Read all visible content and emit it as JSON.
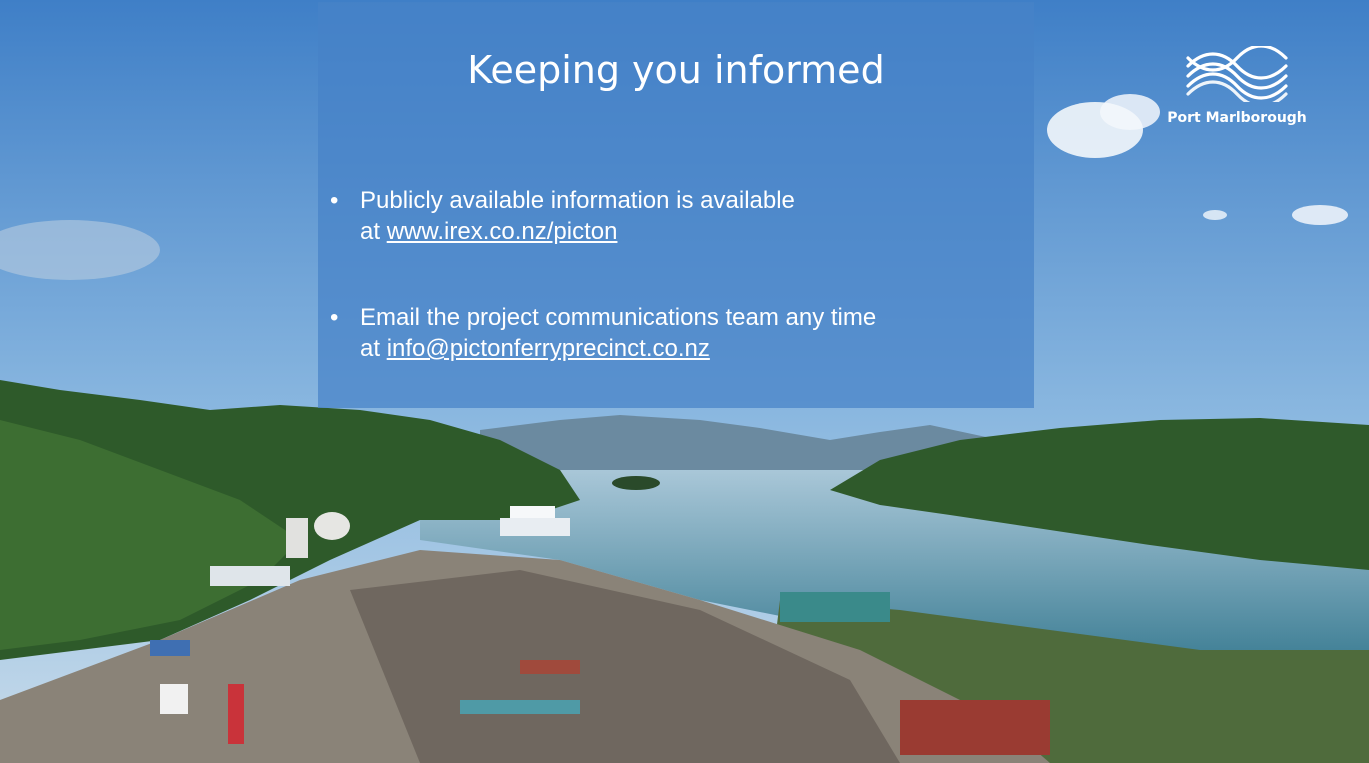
{
  "slide": {
    "title": "Keeping you informed",
    "bullets": [
      {
        "text": "Publicly available information is available",
        "prefix": "at",
        "link": "www.irex.co.nz/picton"
      },
      {
        "text": "Email the project communications team any time",
        "prefix": "at",
        "link": "info@pictonferryprecinct.co.nz"
      }
    ]
  },
  "logo": {
    "text": "Port Marlborough",
    "icon": "port-marlborough-logo-icon"
  },
  "colors": {
    "panel": "#4682c8",
    "text": "#ffffff",
    "sky": "#5b8fc9",
    "water": "#5a93b5",
    "hills": "#2f5a2b"
  }
}
